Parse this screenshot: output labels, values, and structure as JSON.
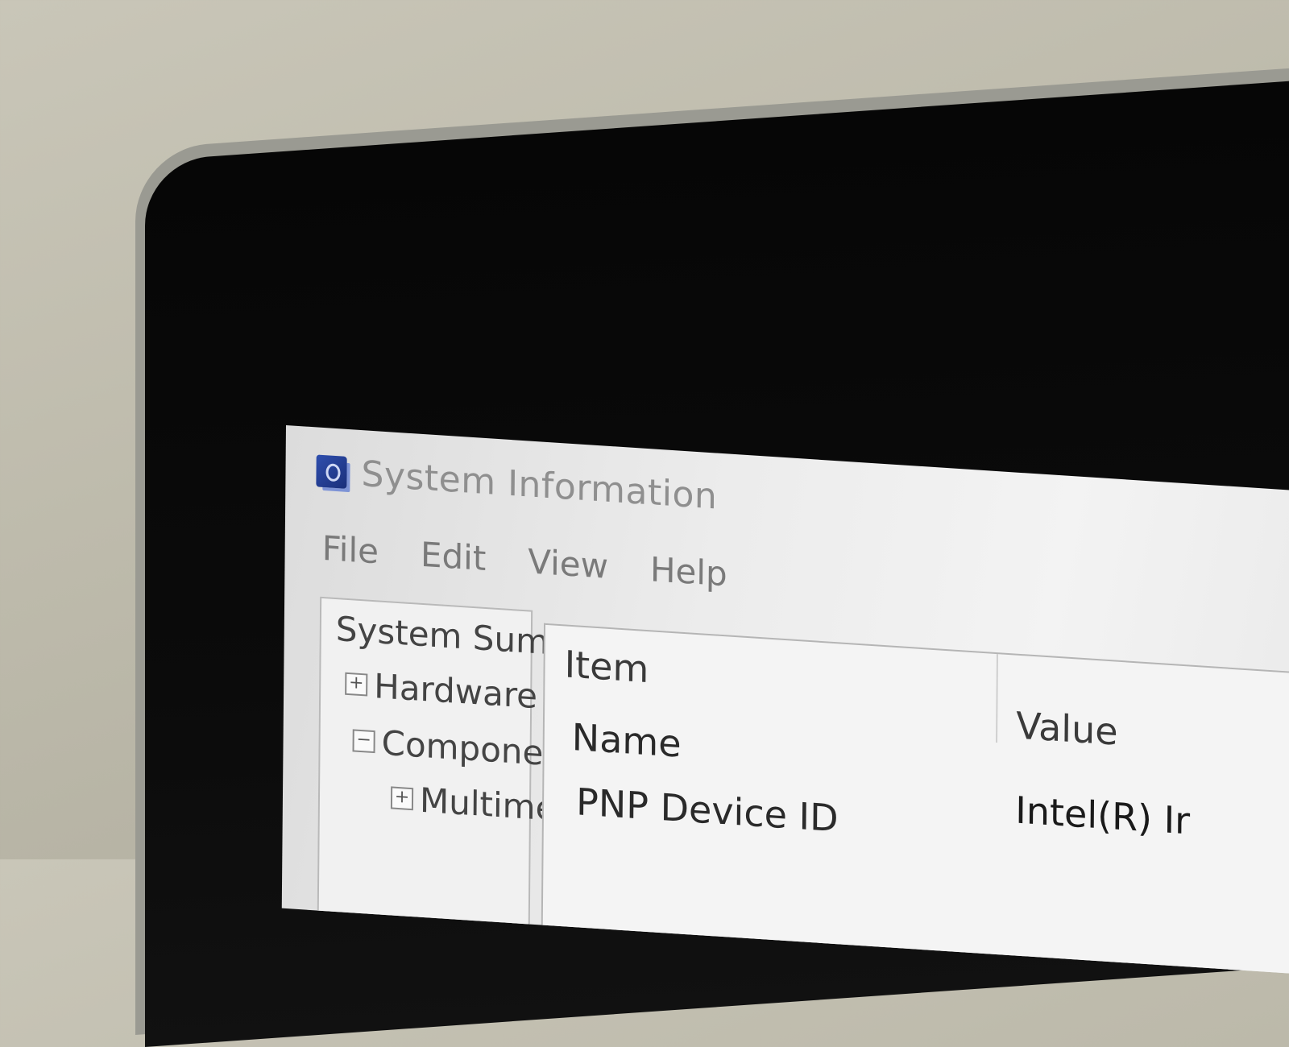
{
  "window": {
    "title": "System Information"
  },
  "menubar": {
    "items": [
      "File",
      "Edit",
      "View",
      "Help"
    ]
  },
  "tree": {
    "items": [
      {
        "label": "System Sum"
      },
      {
        "label": "Hardware",
        "expander": "+"
      },
      {
        "label": "Componer",
        "expander": "−"
      },
      {
        "label": "Multime",
        "expander": "+"
      }
    ]
  },
  "list": {
    "headers": {
      "item": "Item",
      "value": "Value"
    },
    "rows": [
      {
        "item": "Name",
        "value": "Intel(R) Ir"
      },
      {
        "item": "PNP Device ID",
        "value": ""
      }
    ]
  }
}
